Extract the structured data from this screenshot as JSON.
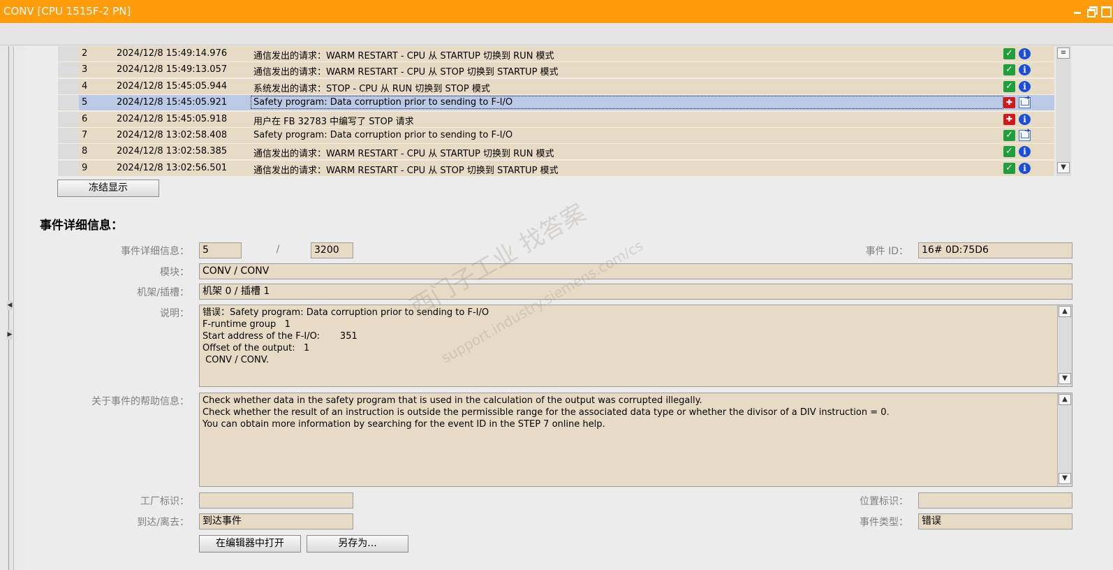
{
  "window": {
    "title": "CONV [CPU 1515F-2 PN]"
  },
  "events": [
    {
      "num": "2",
      "timestamp": "2024/12/8 15:49:14.976",
      "message": "通信发出的请求：WARM RESTART - CPU 从 STARTUP 切换到 RUN 模式",
      "icon_a": "ok-check-icon",
      "icon_b": "info-icon"
    },
    {
      "num": "3",
      "timestamp": "2024/12/8 15:49:13.057",
      "message": "通信发出的请求：WARM RESTART - CPU 从 STOP 切换到 STARTUP 模式",
      "icon_a": "ok-check-icon",
      "icon_b": "info-icon"
    },
    {
      "num": "4",
      "timestamp": "2024/12/8 15:45:05.944",
      "message": "系统发出的请求：STOP - CPU 从 RUN 切换到 STOP 模式",
      "icon_a": "ok-check-icon",
      "icon_b": "info-icon"
    },
    {
      "num": "5",
      "timestamp": "2024/12/8 15:45:05.921",
      "message": "Safety program: Data corruption prior to sending to F-I/O",
      "icon_a": "fault-icon",
      "icon_b": "outgoing-message-icon",
      "selected": true
    },
    {
      "num": "6",
      "timestamp": "2024/12/8 15:45:05.918",
      "message": "用户在 FB 32783 中编写了 STOP 请求",
      "icon_a": "fault-icon",
      "icon_b": "info-icon"
    },
    {
      "num": "7",
      "timestamp": "2024/12/8 13:02:58.408",
      "message": "Safety program: Data corruption prior to sending to F-I/O",
      "icon_a": "ok-check-icon",
      "icon_b": "outgoing-message-icon"
    },
    {
      "num": "8",
      "timestamp": "2024/12/8 13:02:58.385",
      "message": "通信发出的请求：WARM RESTART - CPU 从 STARTUP 切换到 RUN 模式",
      "icon_a": "ok-check-icon",
      "icon_b": "info-icon"
    },
    {
      "num": "9",
      "timestamp": "2024/12/8 13:02:56.501",
      "message": "通信发出的请求：WARM RESTART - CPU 从 STOP 切换到 STARTUP 模式",
      "icon_a": "ok-check-icon",
      "icon_b": "info-icon"
    }
  ],
  "freeze_button": "冻结显示",
  "details": {
    "section_title": "事件详细信息：",
    "event_detail_label": "事件详细信息：",
    "event_index": "5",
    "separator": "/",
    "event_total": "3200",
    "event_id_label": "事件 ID：",
    "event_id": "16# 0D:75D6",
    "module_label": "模块：",
    "module": "CONV / CONV",
    "rack_slot_label": "机架/插槽：",
    "rack_slot": "机架 0 / 插槽 1",
    "description_label": "说明：",
    "description": "错误：Safety program: Data corruption prior to sending to F-I/O\nF-runtime group   1\nStart address of the F-I/O:       351\nOffset of the output:   1\n CONV / CONV.",
    "help_label": "关于事件的帮助信息：",
    "help": "Check whether data in the safety program that is used in the calculation of the output was corrupted illegally.\nCheck whether the result of an instruction is outside the permissible range for the associated data type or whether the divisor of a DIV instruction = 0.\nYou can obtain more information by searching for the event ID in the STEP 7 online help.",
    "plant_id_label": "工厂标识：",
    "plant_id": "",
    "location_id_label": "位置标识：",
    "location_id": "",
    "coming_going_label": "到达/离去：",
    "coming_going": "到达事件",
    "event_type_label": "事件类型：",
    "event_type": "错误"
  },
  "buttons": {
    "open_in_editor": "在编辑器中打开",
    "save_as": "另存为..."
  },
  "watermark": {
    "line1": "西门子工业 找答案",
    "line2": "support.industry.siemens.com/cs"
  }
}
